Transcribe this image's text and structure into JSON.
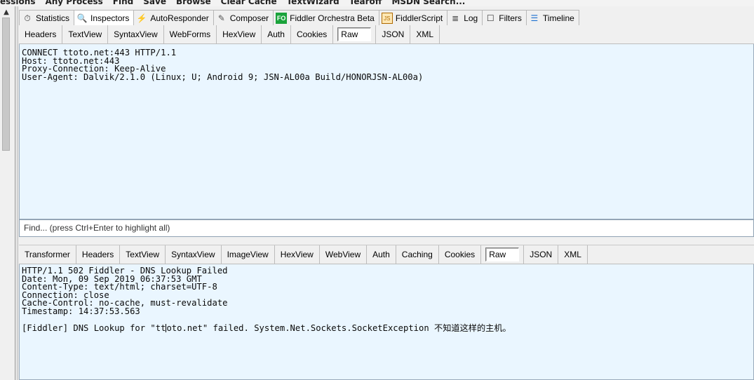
{
  "toolbar_clipped": [
    "essions",
    "Any Process",
    "Find",
    "Save",
    "Browse",
    "Clear Cache",
    "TextWizard",
    "Tearoff",
    "MSDN Search..."
  ],
  "main_tabs": [
    {
      "label": "Statistics",
      "icon": "stopwatch-icon",
      "glyph": "⏱"
    },
    {
      "label": "Inspectors",
      "icon": "magnifier-icon",
      "glyph": "🔍",
      "active": true
    },
    {
      "label": "AutoResponder",
      "icon": "lightning-icon",
      "glyph": "⚡"
    },
    {
      "label": "Composer",
      "icon": "pencil-icon",
      "glyph": "✎"
    },
    {
      "label": "Fiddler Orchestra Beta",
      "icon": "fo-badge-icon",
      "glyph": "FO"
    },
    {
      "label": "FiddlerScript",
      "icon": "script-icon",
      "glyph": "JS"
    },
    {
      "label": "Log",
      "icon": "log-icon",
      "glyph": "≣"
    },
    {
      "label": "Filters",
      "icon": "checkbox-icon",
      "glyph": "☐"
    },
    {
      "label": "Timeline",
      "icon": "timeline-icon",
      "glyph": "☰"
    }
  ],
  "request": {
    "tabs": [
      "Headers",
      "TextView",
      "SyntaxView",
      "WebForms",
      "HexView",
      "Auth",
      "Cookies",
      "Raw",
      "JSON",
      "XML"
    ],
    "active_tab": "Raw",
    "lines": [
      "CONNECT ttoto.net:443 HTTP/1.1",
      "Host: ttoto.net:443",
      "Proxy-Connection: Keep-Alive",
      "User-Agent: Dalvik/2.1.0 (Linux; U; Android 9; JSN-AL00a Build/HONORJSN-AL00a)"
    ],
    "find_placeholder": "Find... (press Ctrl+Enter to highlight all)"
  },
  "response": {
    "tabs": [
      "Transformer",
      "Headers",
      "TextView",
      "SyntaxView",
      "ImageView",
      "HexView",
      "WebView",
      "Auth",
      "Caching",
      "Cookies",
      "Raw",
      "JSON",
      "XML"
    ],
    "active_tab": "Raw",
    "lines": [
      "HTTP/1.1 502 Fiddler - DNS Lookup Failed",
      "Date: Mon, 09 Sep 2019 06:37:53 GMT",
      "Content-Type: text/html; charset=UTF-8",
      "Connection: close",
      "Cache-Control: no-cache, must-revalidate",
      "Timestamp: 14:37:53.563",
      ""
    ],
    "body_before_caret": "[Fiddler] DNS Lookup for \"tt",
    "body_after_caret": "oto.net\" failed. System.Net.Sockets.SocketException 不知道这样的主机。"
  }
}
